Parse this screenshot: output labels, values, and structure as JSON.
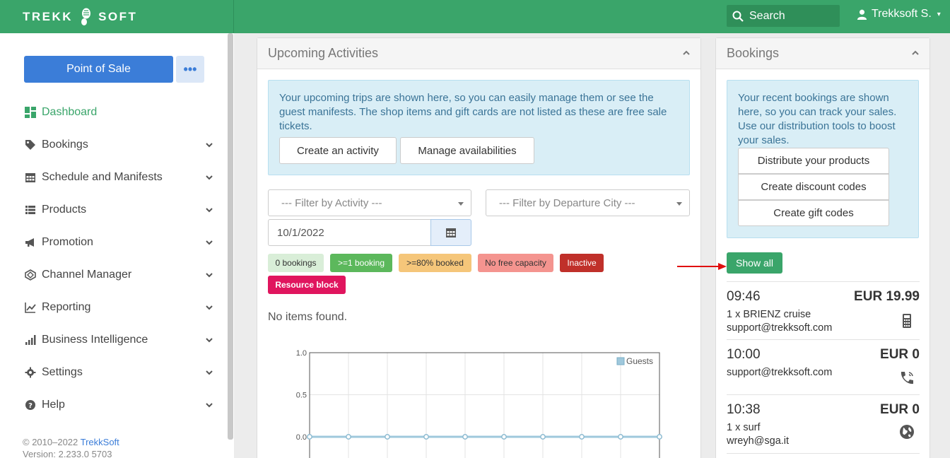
{
  "header": {
    "logo_left": "TREKK",
    "logo_right": "SOFT",
    "search_label": "Search",
    "user_name": "Trekksoft S."
  },
  "sidebar": {
    "pos_button": "Point of Sale",
    "more_button": "•••",
    "items": [
      {
        "label": "Dashboard",
        "icon": "dashboard-icon",
        "active": true
      },
      {
        "label": "Bookings",
        "icon": "tag-icon"
      },
      {
        "label": "Schedule and Manifests",
        "icon": "calendar-icon"
      },
      {
        "label": "Products",
        "icon": "list-icon"
      },
      {
        "label": "Promotion",
        "icon": "megaphone-icon"
      },
      {
        "label": "Channel Manager",
        "icon": "channel-icon"
      },
      {
        "label": "Reporting",
        "icon": "line-chart-icon"
      },
      {
        "label": "Business Intelligence",
        "icon": "bar-chart-icon"
      },
      {
        "label": "Settings",
        "icon": "gear-icon"
      },
      {
        "label": "Help",
        "icon": "question-icon"
      }
    ],
    "footer_copyright": "© 2010–2022 ",
    "footer_link": "TrekkSoft",
    "footer_version": "Version: 2.233.0 5703"
  },
  "upcoming": {
    "title": "Upcoming Activities",
    "info": "Your upcoming trips are shown here, so you can easily manage them or see the guest manifests. The shop items and gift cards are not listed as these are free sale tickets.",
    "create_activity": "Create an activity",
    "manage_availabilities": "Manage availabilities",
    "filter_activity": "--- Filter by Activity ---",
    "filter_city": "--- Filter by Departure City ---",
    "date_value": "10/1/2022",
    "legend": [
      {
        "label": "0 bookings",
        "bg": "#d9eed8",
        "fg": "#333"
      },
      {
        "label": ">=1 booking",
        "bg": "#5cb85c",
        "fg": "#fff"
      },
      {
        "label": ">=80% booked",
        "bg": "#f5c67a",
        "fg": "#333"
      },
      {
        "label": "No free capacity",
        "bg": "#f4948f",
        "fg": "#333"
      },
      {
        "label": "Inactive",
        "bg": "#c0302a",
        "fg": "#fff"
      },
      {
        "label": "Resource block",
        "bg": "#e0155e",
        "fg": "#fff"
      }
    ],
    "no_items": "No items found."
  },
  "chart_data": {
    "type": "line",
    "series": [
      {
        "name": "Guests",
        "values": [
          0,
          0,
          0,
          0,
          0,
          0,
          0,
          0,
          0,
          0
        ]
      }
    ],
    "yticks": [
      "1.0",
      "0.5",
      "0.0"
    ],
    "ylim": [
      0,
      1
    ],
    "grid": true,
    "legend": "top-right"
  },
  "bookings": {
    "title": "Bookings",
    "info": "Your recent bookings are shown here, so you can track your sales. Use our distribution tools to boost your sales.",
    "links": [
      "Distribute your products",
      "Create discount codes",
      "Create gift codes"
    ],
    "show_all": "Show all",
    "items": [
      {
        "time": "09:46",
        "amount": "EUR 19.99",
        "line1": "1 x BRIENZ cruise",
        "line2": "support@trekksoft.com",
        "icon": "calculator-icon"
      },
      {
        "time": "10:00",
        "amount": "EUR 0",
        "line1": "",
        "line2": "support@trekksoft.com",
        "icon": "phone-icon"
      },
      {
        "time": "10:38",
        "amount": "EUR 0",
        "line1": "1 x surf",
        "line2": "wreyh@sga.it",
        "icon": "globe-icon"
      }
    ]
  }
}
